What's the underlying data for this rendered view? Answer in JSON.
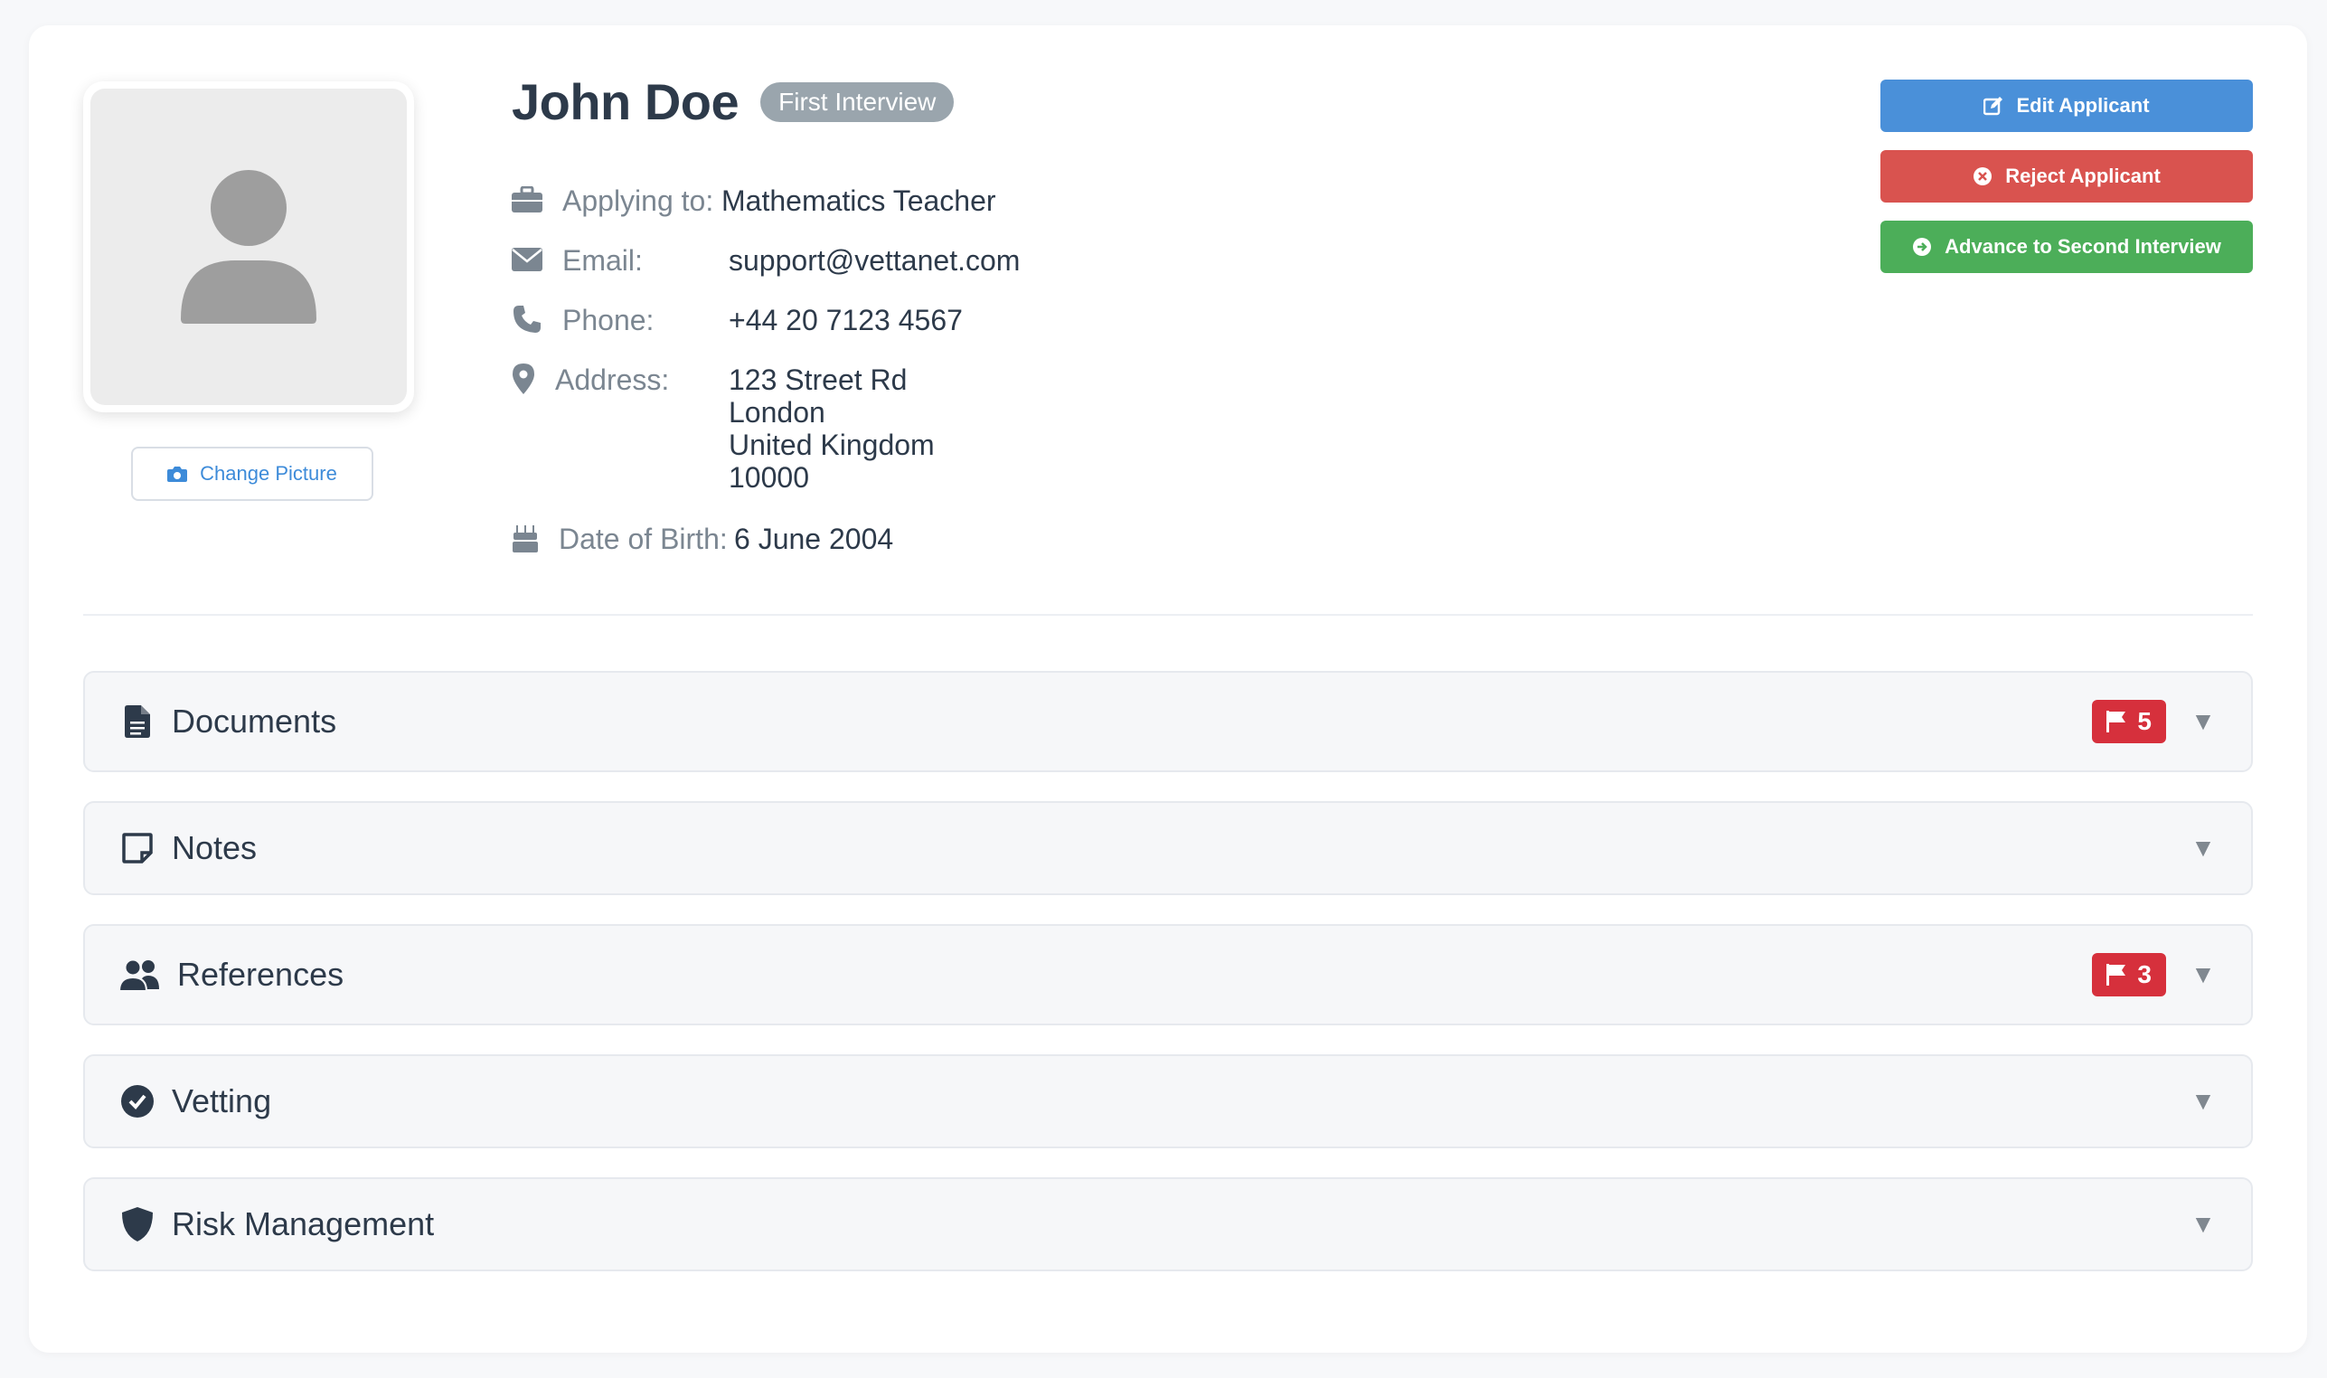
{
  "applicant": {
    "name": "John Doe",
    "stage": "First Interview"
  },
  "picture": {
    "change_label": "Change Picture"
  },
  "details": {
    "applying_label": "Applying to:",
    "applying_value": "Mathematics Teacher",
    "email_label": "Email:",
    "email_value": "support@vettanet.com",
    "phone_label": "Phone:",
    "phone_value": "+44 20 7123 4567",
    "address_label": "Address:",
    "address_lines": [
      "123 Street Rd",
      "London",
      "United Kingdom",
      "10000"
    ],
    "dob_label": "Date of Birth:",
    "dob_value": "6 June 2004"
  },
  "actions": {
    "edit_label": "Edit Applicant",
    "reject_label": "Reject Applicant",
    "advance_label": "Advance to Second Interview"
  },
  "sections": [
    {
      "title": "Documents",
      "icon": "document-icon",
      "flag_count": "5"
    },
    {
      "title": "Notes",
      "icon": "note-icon"
    },
    {
      "title": "References",
      "icon": "users-icon",
      "flag_count": "3"
    },
    {
      "title": "Vetting",
      "icon": "check-circle-icon"
    },
    {
      "title": "Risk Management",
      "icon": "shield-icon"
    }
  ],
  "colors": {
    "edit": "#4a90d9",
    "reject": "#d9534f",
    "advance": "#4cae59",
    "flag": "#d6303c",
    "stage_badge": "#9aa5ad"
  }
}
